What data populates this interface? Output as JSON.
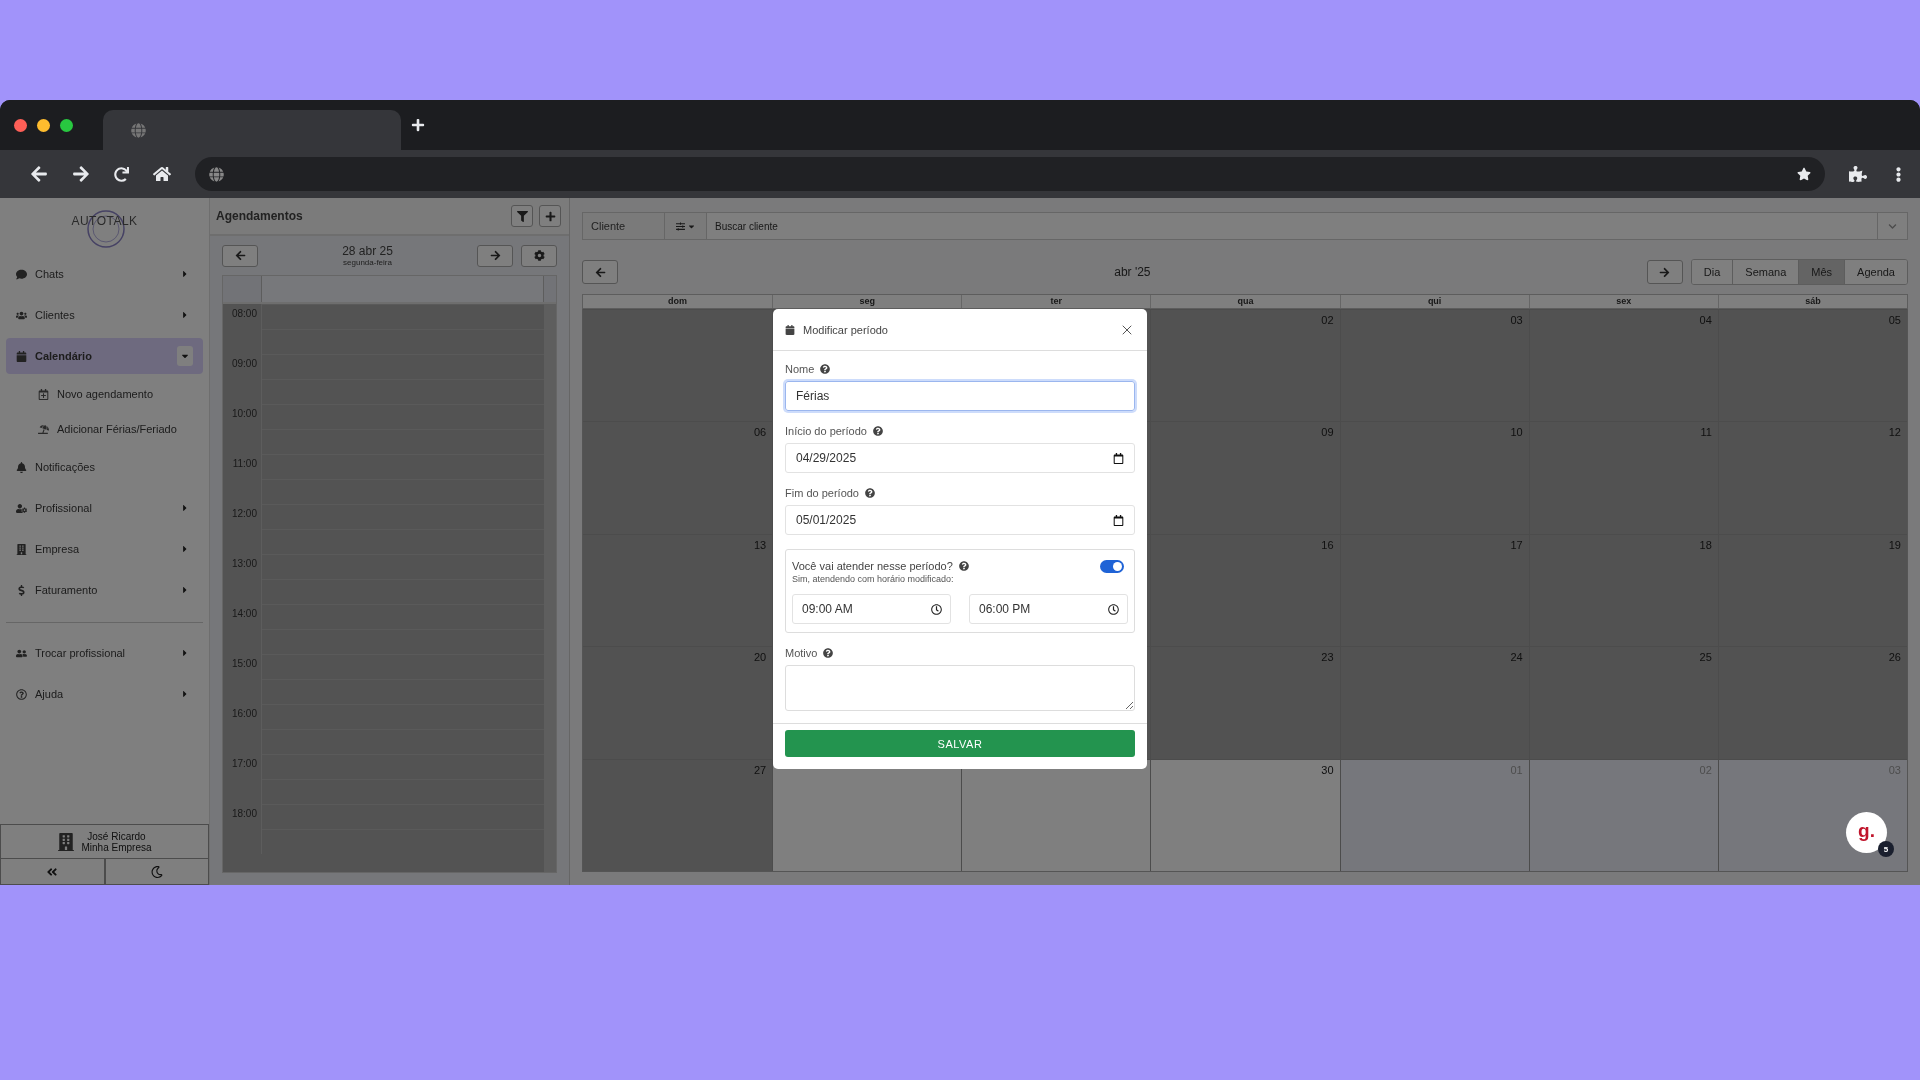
{
  "sidebar": {
    "logo": "AUTOTALK",
    "menu": [
      {
        "label": "Chats",
        "selected": false,
        "expanded": false
      },
      {
        "label": "Clientes",
        "selected": false,
        "expanded": false
      },
      {
        "label": "Calendário",
        "selected": true,
        "expanded": true,
        "children": [
          {
            "label": "Novo agendamento"
          },
          {
            "label": "Adicionar Férias/Feriado"
          }
        ]
      },
      {
        "label": "Notificações",
        "selected": false
      },
      {
        "label": "Profissional",
        "selected": false,
        "expanded": false
      },
      {
        "label": "Empresa",
        "selected": false,
        "expanded": false
      },
      {
        "label": "Faturamento",
        "selected": false,
        "expanded": false
      }
    ],
    "menu_secondary": [
      {
        "label": "Trocar profissional",
        "selected": false,
        "expanded": false
      },
      {
        "label": "Ajuda",
        "selected": false,
        "expanded": false
      }
    ],
    "user": {
      "name": "José Ricardo",
      "company": "Minha Empresa"
    }
  },
  "schedule": {
    "title": "Agendamentos",
    "date": "28 abr 25",
    "weekday": "segunda-feira",
    "hours": [
      "08:00",
      "09:00",
      "10:00",
      "11:00",
      "12:00",
      "13:00",
      "14:00",
      "15:00",
      "16:00",
      "17:00",
      "18:00"
    ]
  },
  "main": {
    "client_filter": {
      "label": "Cliente",
      "placeholder": "Buscar cliente"
    },
    "month_title": "abr '25",
    "views": [
      {
        "label": "Dia",
        "selected": false
      },
      {
        "label": "Semana",
        "selected": false
      },
      {
        "label": "Mês",
        "selected": true
      },
      {
        "label": "Agenda",
        "selected": false
      }
    ],
    "weekdays": [
      "dom",
      "seg",
      "ter",
      "qua",
      "qui",
      "sex",
      "sáb"
    ],
    "weeks": [
      {
        "dom": {
          "past": true
        },
        "qua": {
          "day": "02",
          "past": true
        },
        "qui": {
          "day": "03",
          "past": true
        },
        "sex": {
          "day": "04",
          "past": true
        },
        "sab": {
          "day": "05",
          "past": true
        }
      },
      {
        "dom": {
          "day": "06",
          "past": true
        },
        "qua": {
          "day": "09",
          "past": true
        },
        "qui": {
          "day": "10",
          "past": true
        },
        "sex": {
          "day": "11",
          "past": true
        },
        "sab": {
          "day": "12",
          "past": true
        }
      },
      {
        "dom": {
          "day": "13",
          "past": true
        },
        "qua": {
          "day": "16",
          "past": true
        },
        "qui": {
          "day": "17",
          "past": true
        },
        "sex": {
          "day": "18",
          "past": true
        },
        "sab": {
          "day": "19",
          "past": true
        }
      },
      {
        "dom": {
          "day": "20",
          "past": true
        },
        "qua": {
          "day": "23",
          "past": true
        },
        "qui": {
          "day": "24",
          "past": true
        },
        "sex": {
          "day": "25",
          "past": true
        },
        "sab": {
          "day": "26",
          "past": true
        }
      },
      {
        "dom": {
          "day": "27",
          "past": true
        },
        "seg": {
          "past": false
        },
        "ter": {
          "past": false
        },
        "qua": {
          "day": "30",
          "past": false
        },
        "qui": {
          "day": "01",
          "other_month": true
        },
        "sex": {
          "day": "02",
          "other_month": true
        },
        "sab": {
          "day": "03",
          "other_month": true
        }
      }
    ]
  },
  "modal": {
    "title": "Modificar período",
    "fields": [
      {
        "label": "Nome",
        "value": "Férias",
        "kind": "text",
        "focused": true
      },
      {
        "label": "Início do período",
        "value": "04/29/2025",
        "kind": "date",
        "focused": false
      },
      {
        "label": "Fim do período",
        "value": "05/01/2025",
        "kind": "date",
        "focused": false
      }
    ],
    "attend": {
      "question": "Você vai atender nesse período?",
      "note": "Sim, atendendo com horário modificado:",
      "on": true,
      "start": "09:00 AM",
      "end": "06:00 PM"
    },
    "reason": {
      "label": "Motivo"
    },
    "submit": "SALVAR"
  },
  "chat_widget": {
    "logo": "g.",
    "badge": "5"
  }
}
